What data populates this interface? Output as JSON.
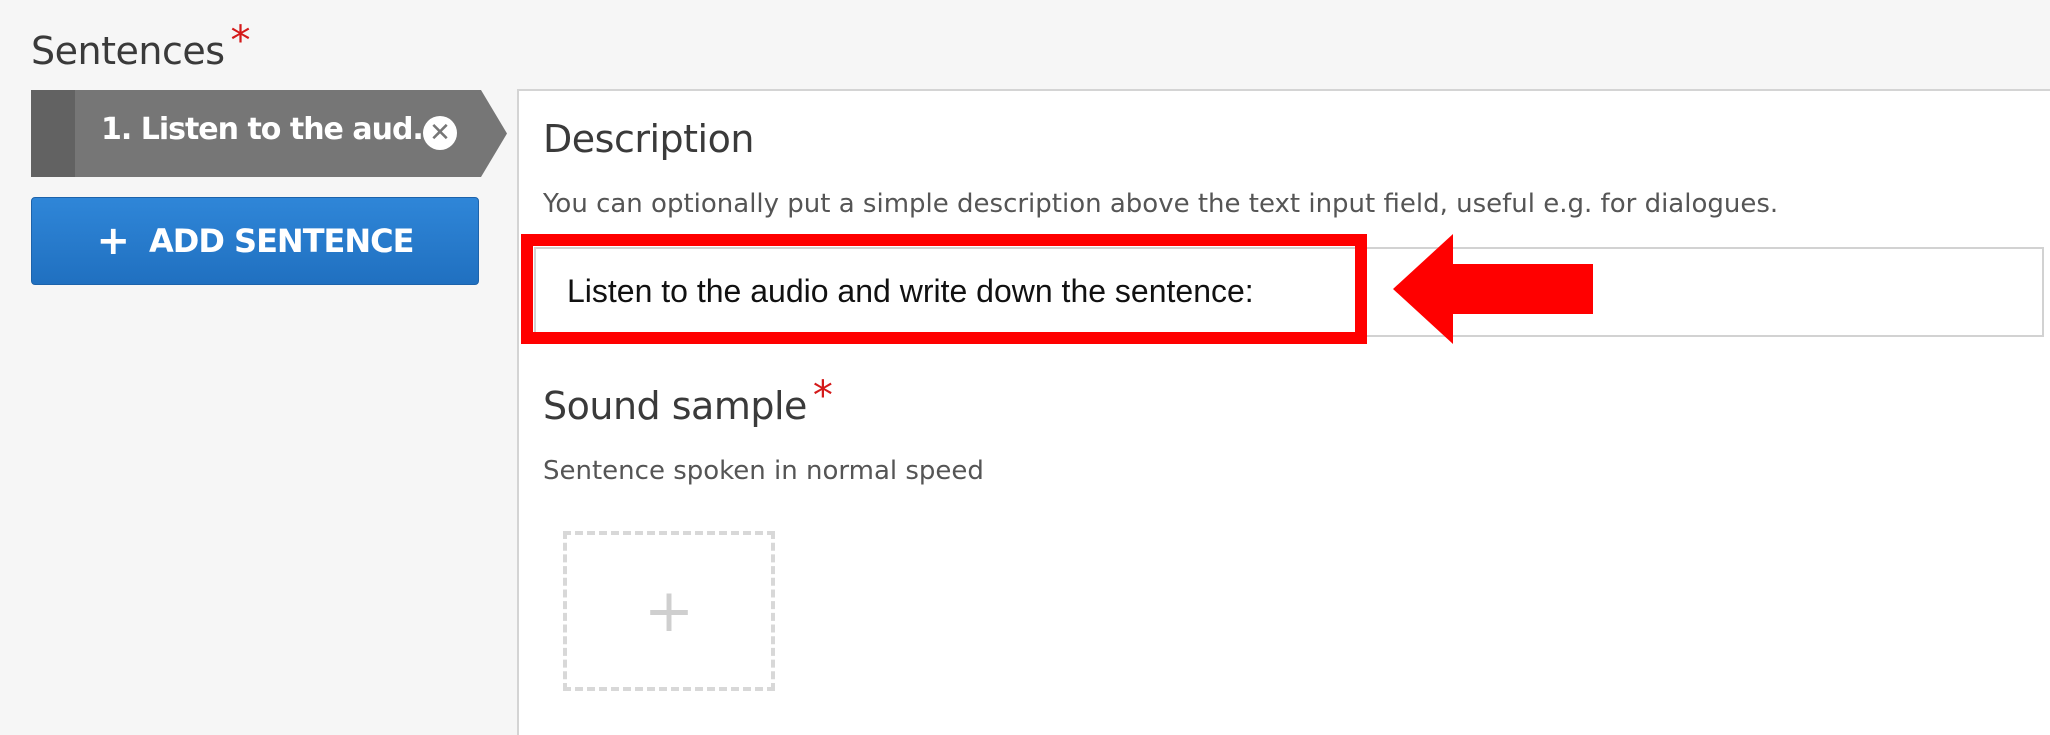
{
  "section": {
    "label": "Sentences",
    "required_mark": "*"
  },
  "tab": {
    "label": "1. Listen to the aud...",
    "remove_glyph": "✕"
  },
  "add_button": {
    "icon": "+",
    "label": "ADD SENTENCE"
  },
  "description": {
    "title": "Description",
    "help": "You can optionally put a simple description above the text input field, useful e.g. for dialogues.",
    "value": "Listen to the audio and write down the sentence:"
  },
  "sound_sample": {
    "title": "Sound sample",
    "required_mark": "*",
    "help": "Sentence spoken in normal speed",
    "upload_icon": "+"
  },
  "colors": {
    "accent_blue": "#2a7dd0",
    "tab_gray": "#767676",
    "highlight_red": "#ff0000",
    "required_red": "#d41a1a"
  },
  "icons": {
    "remove": "remove-circle-icon",
    "add": "plus-icon",
    "annotation": "arrow-left-icon"
  }
}
